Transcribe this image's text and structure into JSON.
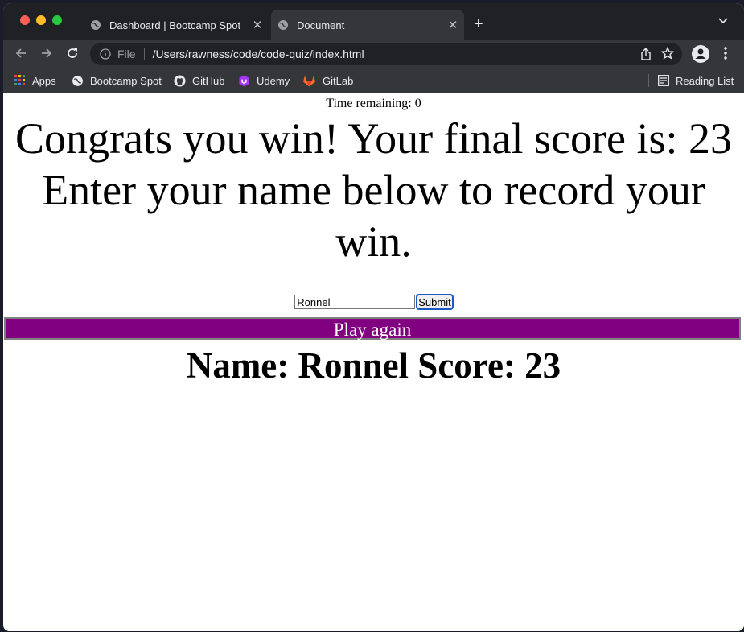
{
  "browser": {
    "tabs": [
      {
        "title": "Dashboard | Bootcamp Spot"
      },
      {
        "title": "Document"
      }
    ],
    "address": {
      "scheme_label": "File",
      "url": "/Users/rawness/code/code-quiz/index.html"
    },
    "bookmarks": [
      {
        "label": "Apps"
      },
      {
        "label": "Bootcamp Spot"
      },
      {
        "label": "GitHub"
      },
      {
        "label": "Udemy"
      },
      {
        "label": "GitLab"
      }
    ],
    "reading_list": "Reading List"
  },
  "page": {
    "timer": "Time remaining: 0",
    "message": "Congrats you win! Your final score is: 23 Enter your name below to record your win.",
    "name_value": "Ronnel",
    "submit_label": "Submit",
    "play_again_label": "Play again",
    "score_line": "Name: Ronnel Score: 23"
  },
  "colors": {
    "play_again_bg": "#800080",
    "tab_bar": "#202124",
    "toolbar": "#35363a"
  }
}
